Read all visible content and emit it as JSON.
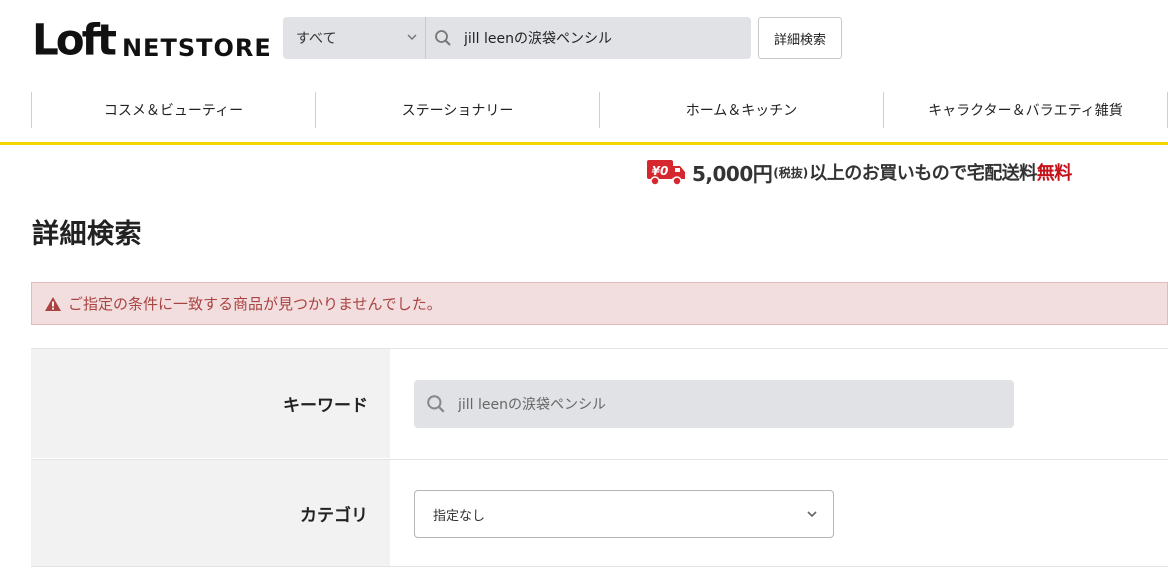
{
  "header": {
    "logo_mark": "Loft",
    "logo_text": "NETSTORE",
    "search": {
      "category_selected": "すべて",
      "query": "jill leenの涙袋ペンシル"
    },
    "advanced_search_label": "詳細検索"
  },
  "nav": {
    "items": [
      {
        "label": "コスメ＆ビューティー"
      },
      {
        "label": "ステーショナリー"
      },
      {
        "label": "ホーム＆キッチン"
      },
      {
        "label": "キャラクター＆バラエティ雑貨"
      }
    ]
  },
  "shipping_banner": {
    "price": "5,000円",
    "tax_note": "(税抜)",
    "text": "以上のお買いもので宅配送料",
    "free": "無料",
    "truck_badge": "¥0"
  },
  "page": {
    "title": "詳細検索",
    "alert": "ご指定の条件に一致する商品が見つかりませんでした。"
  },
  "form": {
    "keyword_label": "キーワード",
    "keyword_value": "jill leenの涙袋ペンシル",
    "category_label": "カテゴリ",
    "category_value": "指定なし"
  },
  "colors": {
    "accent_yellow": "#f2d500",
    "alert_bg": "#f2dede",
    "alert_text": "#a94442",
    "free_red": "#c4121a",
    "truck_red": "#d6262e"
  },
  "icons": [
    "search-icon",
    "chevron-down-icon",
    "warning-icon",
    "truck-icon"
  ]
}
